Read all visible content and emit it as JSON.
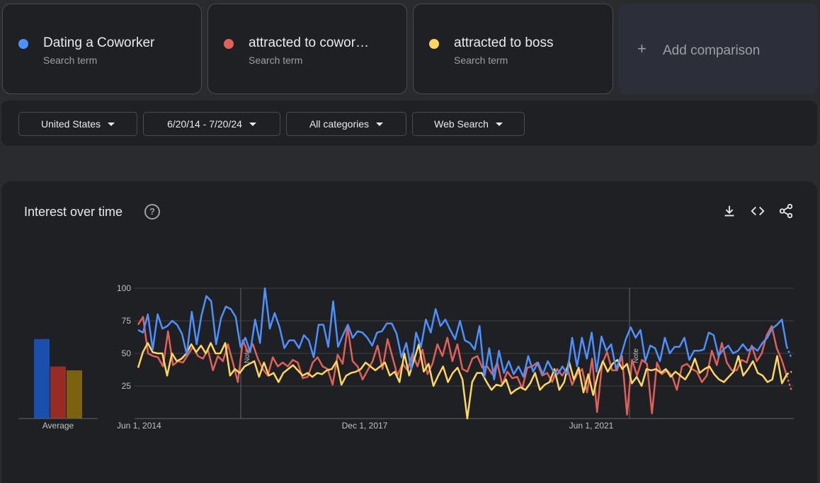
{
  "terms": [
    {
      "name": "Dating a Coworker",
      "subtitle": "Search term",
      "color": "#4d90fe"
    },
    {
      "name": "attracted to cowor…",
      "subtitle": "Search term",
      "color": "#e0605a"
    },
    {
      "name": "attracted to boss",
      "subtitle": "Search term",
      "color": "#fdd663"
    }
  ],
  "add_comparison": {
    "label": "Add comparison"
  },
  "filters": {
    "region": "United States",
    "date_range": "6/20/14 - 7/20/24",
    "category": "All categories",
    "search_type": "Web Search"
  },
  "panel": {
    "title": "Interest over time",
    "help_symbol": "?"
  },
  "chart_data": {
    "type": "line",
    "y_ticks": [
      100,
      75,
      50,
      25
    ],
    "ylim": [
      0,
      100
    ],
    "x_tick_labels": [
      "Jun 1, 2014",
      "Dec 1, 2017",
      "Jun 1, 2021"
    ],
    "note_label": "Note",
    "average": {
      "label": "Average",
      "values": [
        61,
        40,
        37
      ],
      "colors": [
        "#1a4fad",
        "#982b24",
        "#7a6210"
      ]
    },
    "series": [
      {
        "name": "Dating a Coworker",
        "color": "#4d90fe",
        "values": [
          68,
          66,
          80,
          53,
          80,
          69,
          71,
          75,
          72,
          65,
          49,
          82,
          57,
          79,
          94,
          90,
          57,
          77,
          86,
          84,
          78,
          55,
          62,
          51,
          76,
          58,
          100,
          69,
          81,
          70,
          54,
          60,
          60,
          54,
          64,
          60,
          47,
          72,
          72,
          55,
          90,
          55,
          64,
          72,
          62,
          67,
          66,
          62,
          56,
          66,
          67,
          73,
          73,
          65,
          47,
          58,
          38,
          66,
          55,
          76,
          66,
          84,
          71,
          76,
          68,
          61,
          75,
          60,
          58,
          53,
          71,
          32,
          54,
          30,
          52,
          35,
          44,
          34,
          40,
          32,
          48,
          36,
          43,
          34,
          44,
          37,
          34,
          40,
          34,
          62,
          40,
          62,
          46,
          66,
          36,
          63,
          52,
          57,
          38,
          48,
          61,
          70,
          62,
          68,
          44,
          56,
          54,
          44,
          62,
          50,
          55,
          55,
          62,
          45,
          52,
          52,
          53,
          66,
          64,
          48,
          53,
          56,
          50,
          52,
          57,
          52,
          55,
          52,
          58,
          62,
          69,
          72,
          76,
          55,
          46
        ]
      },
      {
        "name": "attracted to coworker",
        "color": "#e0605a",
        "values": [
          72,
          78,
          50,
          48,
          47,
          40,
          67,
          41,
          44,
          43,
          49,
          55,
          48,
          46,
          53,
          37,
          48,
          44,
          57,
          43,
          28,
          60,
          51,
          57,
          46,
          38,
          33,
          47,
          40,
          43,
          40,
          45,
          43,
          31,
          32,
          43,
          47,
          40,
          38,
          26,
          49,
          42,
          70,
          44,
          40,
          30,
          37,
          44,
          56,
          38,
          61,
          47,
          33,
          42,
          37,
          50,
          40,
          53,
          34,
          42,
          57,
          48,
          62,
          44,
          57,
          38,
          36,
          46,
          48,
          39,
          40,
          34,
          43,
          26,
          36,
          31,
          32,
          23,
          39,
          40,
          43,
          33,
          35,
          28,
          38,
          33,
          39,
          26,
          34,
          38,
          20,
          46,
          5,
          42,
          51,
          37,
          37,
          48,
          3,
          45,
          33,
          45,
          42,
          4,
          43,
          34,
          37,
          33,
          22,
          40,
          42,
          38,
          36,
          28,
          33,
          52,
          41,
          58,
          43,
          37,
          37,
          45,
          43,
          56,
          44,
          50,
          64,
          71,
          54,
          45,
          33,
          21
        ]
      },
      {
        "name": "attracted to boss",
        "color": "#fdd663",
        "values": [
          39,
          51,
          58,
          51,
          50,
          50,
          33,
          50,
          44,
          46,
          50,
          57,
          51,
          56,
          50,
          58,
          50,
          50,
          58,
          33,
          38,
          35,
          40,
          42,
          44,
          32,
          43,
          33,
          35,
          28,
          35,
          38,
          41,
          37,
          33,
          35,
          32,
          35,
          34,
          37,
          38,
          44,
          26,
          33,
          35,
          36,
          38,
          43,
          40,
          37,
          40,
          43,
          33,
          36,
          28,
          50,
          33,
          45,
          57,
          36,
          42,
          25,
          33,
          40,
          28,
          35,
          39,
          30,
          0,
          28,
          35,
          35,
          28,
          22,
          26,
          25,
          30,
          19,
          22,
          24,
          22,
          27,
          35,
          22,
          26,
          28,
          38,
          22,
          28,
          44,
          30,
          39,
          20,
          34,
          18,
          34,
          44,
          36,
          42,
          45,
          38,
          42,
          27,
          32,
          25,
          38,
          37,
          38,
          35,
          38,
          32,
          36,
          33,
          30,
          36,
          46,
          35,
          38,
          40,
          34,
          30,
          28,
          32,
          36,
          48,
          33,
          38,
          44,
          35,
          33,
          28,
          30,
          48,
          27,
          34,
          36
        ]
      }
    ]
  }
}
